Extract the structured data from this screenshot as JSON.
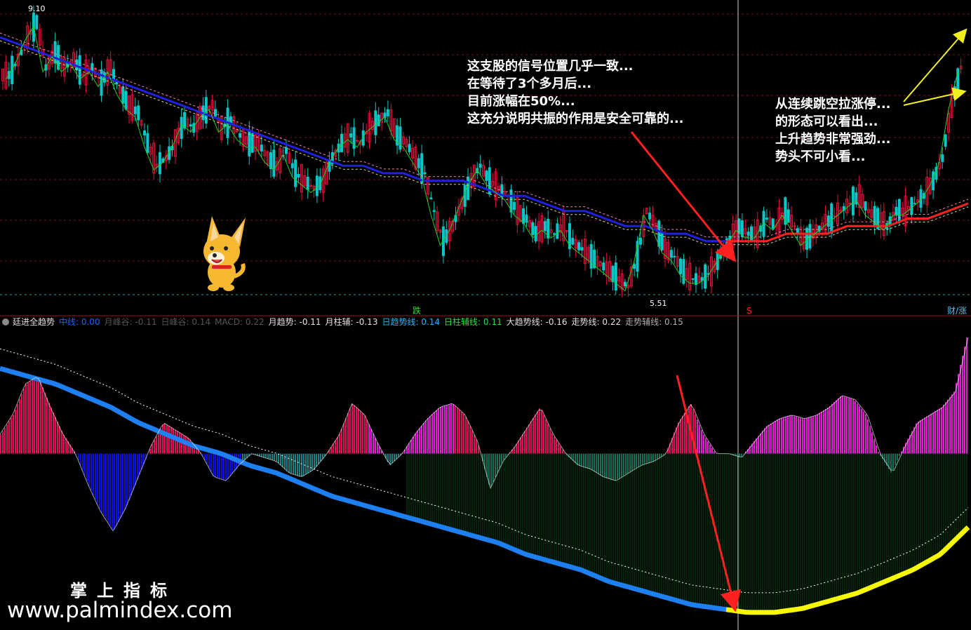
{
  "colors": {
    "background": "#000000",
    "grid": "#7a1010",
    "candle_up": "#e0103a",
    "candle_down": "#00c8c8",
    "ma_blue": "#2020e0",
    "ma_red": "#ff2020",
    "ma_yellow": "#d8d890",
    "ma_pink": "#ff80c0",
    "ma_green": "#20d020",
    "bar_pos_red": "#e0105a",
    "bar_pos_magenta": "#e020d0",
    "bar_neg_blue": "#1010e0",
    "bar_neg_teal": "#208080",
    "bar_neg_green": "#0a5a1a",
    "trend_blue": "#1e7ff0",
    "trend_yellow": "#f8f800",
    "arrow_red": "#ff2020",
    "arrow_yellow": "#f0f020",
    "annotation_bg": "#6a00d0"
  },
  "price_panel": {
    "max_label": "9.10",
    "min_label": "5.51",
    "marker_die": "跌",
    "marker_s": "S",
    "marker_caizhang": "财/涨"
  },
  "annotations": {
    "left": [
      "这支股的信号位置几乎一致...",
      "在等待了3个多月后...",
      "目前涨幅在50%...",
      "这充分说明共振的作用是安全可靠的..."
    ],
    "right": [
      "从连续跳空拉涨停...",
      "的形态可以看出...",
      "上升趋势非常强劲...",
      "势头不可小看..."
    ]
  },
  "indicator_bar": {
    "name": "廷进全趋势",
    "items": [
      {
        "text": "中线: 0.00",
        "color": "#2060ff"
      },
      {
        "text": "月峰谷: -0.11",
        "color": "#555555"
      },
      {
        "text": "日峰谷: 0.14",
        "color": "#555555"
      },
      {
        "text": "MACD: 0.22",
        "color": "#555555"
      },
      {
        "text": "月趋势: -0.11",
        "color": "#e0e0e0"
      },
      {
        "text": "月柱辅: -0.13",
        "color": "#e0e0e0"
      },
      {
        "text": "日趋势线: 0.14",
        "color": "#20b0ff"
      },
      {
        "text": "日柱辅线: 0.11",
        "color": "#20e040"
      },
      {
        "text": "大趋势线: -0.16",
        "color": "#e0e0e0"
      },
      {
        "text": "走势线: 0.22",
        "color": "#e0e0e0"
      },
      {
        "text": "走势辅线: 0.15",
        "color": "#b0b0b0"
      }
    ]
  },
  "watermark": {
    "cn": "掌上指标",
    "url": "www.palmindex.com"
  },
  "chart_data": [
    {
      "type": "candlestick",
      "title": "",
      "ylim": [
        5.4,
        9.3
      ],
      "close": [
        8.4,
        8.6,
        8.9,
        9.1,
        8.5,
        8.7,
        8.5,
        8.6,
        8.4,
        8.5,
        8.3,
        8.5,
        8.2,
        8.0,
        7.9,
        7.5,
        7.2,
        7.3,
        7.5,
        7.8,
        7.7,
        7.9,
        8.0,
        7.7,
        7.8,
        7.6,
        7.5,
        7.5,
        7.3,
        7.2,
        7.4,
        7.1,
        7.0,
        6.9,
        7.0,
        7.3,
        7.5,
        7.6,
        7.5,
        7.7,
        7.8,
        7.9,
        7.6,
        7.5,
        7.3,
        7.1,
        6.6,
        6.2,
        6.4,
        6.7,
        7.0,
        7.2,
        7.0,
        6.9,
        6.8,
        6.6,
        6.5,
        6.3,
        6.4,
        6.3,
        6.4,
        6.2,
        6.1,
        6.0,
        5.9,
        5.8,
        5.7,
        5.6,
        6.0,
        6.6,
        6.4,
        6.1,
        6.0,
        5.8,
        5.7,
        5.7,
        5.8,
        6.0,
        6.2,
        6.4,
        6.3,
        6.3,
        6.5,
        6.4,
        6.6,
        6.4,
        6.2,
        6.3,
        6.4,
        6.5,
        6.6,
        6.7,
        6.8,
        6.6,
        6.5,
        6.4,
        6.6,
        6.6,
        6.7,
        6.8,
        7.0,
        7.3,
        8.0,
        8.5
      ],
      "ma_long": [
        8.9,
        8.8,
        8.7,
        8.6,
        8.5,
        8.4,
        8.3,
        8.2,
        8.1,
        8.0,
        7.9,
        7.8,
        7.7,
        7.6,
        7.5,
        7.4,
        7.3,
        7.2,
        7.2,
        7.1,
        7.1,
        7.0,
        7.0,
        7.0,
        6.9,
        6.8,
        6.8,
        6.7,
        6.6,
        6.6,
        6.5,
        6.4,
        6.4,
        6.3,
        6.3,
        6.2,
        6.2,
        6.2,
        6.2,
        6.3,
        6.3,
        6.3,
        6.4,
        6.4,
        6.4,
        6.5,
        6.5,
        6.6,
        6.7
      ]
    },
    {
      "type": "area",
      "title": "",
      "ylim": [
        -0.45,
        0.32
      ],
      "histogram": [
        0.05,
        0.1,
        0.18,
        0.2,
        0.12,
        0.05,
        0.0,
        -0.08,
        -0.15,
        -0.2,
        -0.14,
        -0.06,
        0.02,
        0.08,
        0.06,
        0.04,
        0.0,
        -0.06,
        -0.07,
        -0.03,
        0.0,
        -0.01,
        -0.02,
        -0.05,
        -0.06,
        -0.04,
        0.0,
        0.05,
        0.13,
        0.1,
        0.03,
        -0.03,
        0.0,
        0.05,
        0.09,
        0.12,
        0.13,
        0.1,
        0.03,
        -0.09,
        -0.02,
        0.02,
        0.07,
        0.12,
        0.05,
        0.0,
        -0.03,
        -0.04,
        -0.06,
        -0.07,
        -0.05,
        -0.03,
        -0.02,
        0.0,
        0.08,
        0.13,
        0.05,
        0.0,
        0.0,
        -0.01,
        0.03,
        0.07,
        0.09,
        0.1,
        0.09,
        0.1,
        0.12,
        0.15,
        0.14,
        0.1,
        0.0,
        -0.05,
        0.02,
        0.08,
        0.1,
        0.12,
        0.16,
        0.3
      ],
      "trend_line": [
        0.22,
        0.2,
        0.18,
        0.15,
        0.12,
        0.08,
        0.05,
        0.02,
        0.0,
        -0.03,
        -0.05,
        -0.08,
        -0.11,
        -0.13,
        -0.15,
        -0.17,
        -0.19,
        -0.21,
        -0.23,
        -0.26,
        -0.28,
        -0.3,
        -0.33,
        -0.35,
        -0.37,
        -0.39,
        -0.4,
        -0.41,
        -0.41,
        -0.4,
        -0.38,
        -0.36,
        -0.33,
        -0.3,
        -0.26,
        -0.19
      ]
    }
  ]
}
